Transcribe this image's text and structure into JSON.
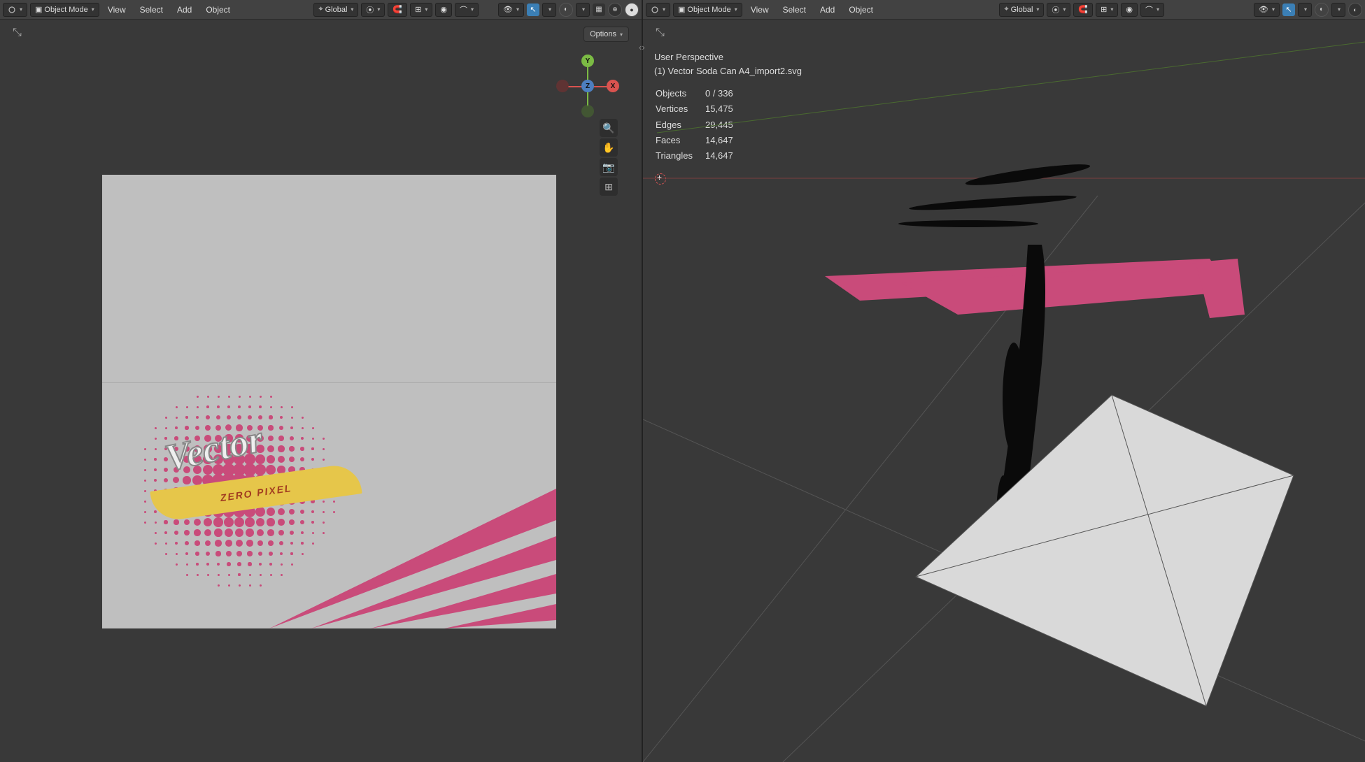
{
  "left_header": {
    "mode": "Object Mode",
    "menus": [
      "View",
      "Select",
      "Add",
      "Object"
    ],
    "orientation": "Global"
  },
  "right_header": {
    "mode": "Object Mode",
    "menus": [
      "View",
      "Select",
      "Add",
      "Object"
    ],
    "orientation": "Global"
  },
  "options_label": "Options",
  "overlay": {
    "perspective": "User Perspective",
    "object_name": "(1) Vector Soda Can A4_import2.svg",
    "stats": {
      "objects_label": "Objects",
      "objects_value": "0 / 336",
      "vertices_label": "Vertices",
      "vertices_value": "15,475",
      "edges_label": "Edges",
      "edges_value": "29,445",
      "faces_label": "Faces",
      "faces_value": "14,647",
      "triangles_label": "Triangles",
      "triangles_value": "14,647"
    }
  },
  "artwork": {
    "title": "Vector",
    "ribbon": "ZERO PIXEL"
  },
  "colors": {
    "pink": "#c94b7a",
    "dark_pink": "#a3385f",
    "yellow": "#e6c64a",
    "grey": "#bfbfbf",
    "axis_x": "#d9534f",
    "axis_y": "#7bbb44",
    "axis_z": "#4d7fbf"
  }
}
